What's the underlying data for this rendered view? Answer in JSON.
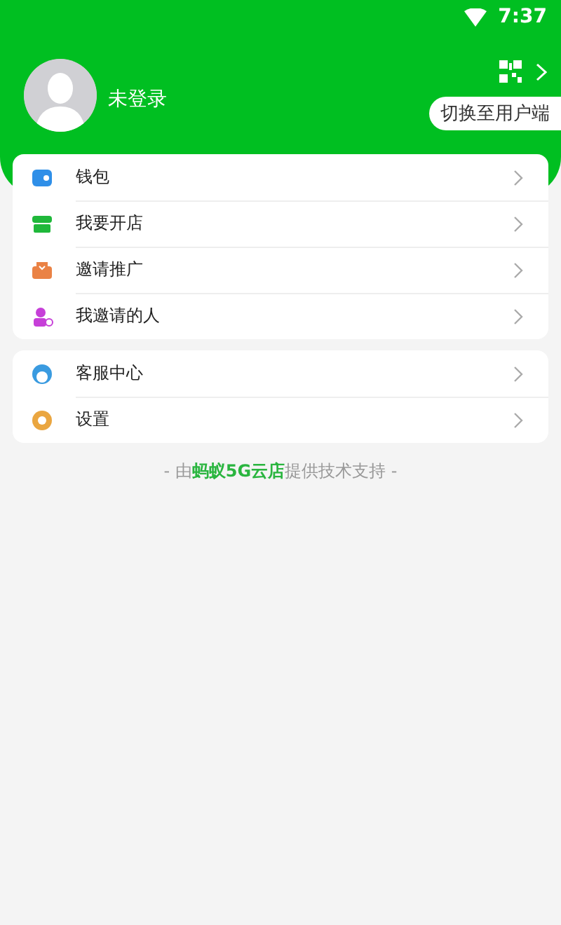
{
  "status_bar": {
    "time": "7:37"
  },
  "profile": {
    "name": "未登录",
    "switch_label": "切换至用户端"
  },
  "groups": [
    {
      "items": [
        {
          "kind": "wallet",
          "label": "钱包",
          "color": "#2f8fe8"
        },
        {
          "kind": "store",
          "label": "我要开店",
          "color": "#1fb83a"
        },
        {
          "kind": "invite",
          "label": "邀请推广",
          "color": "#ea8245"
        },
        {
          "kind": "people",
          "label": "我邀请的人",
          "color": "#c63fd8"
        }
      ]
    },
    {
      "items": [
        {
          "kind": "service",
          "label": "客服中心",
          "color": "#3a9be0"
        },
        {
          "kind": "settings",
          "label": "设置",
          "color": "#eaa640"
        }
      ]
    }
  ],
  "footer": "- 由**蚂蚁5G云店**提供技术支持 -"
}
